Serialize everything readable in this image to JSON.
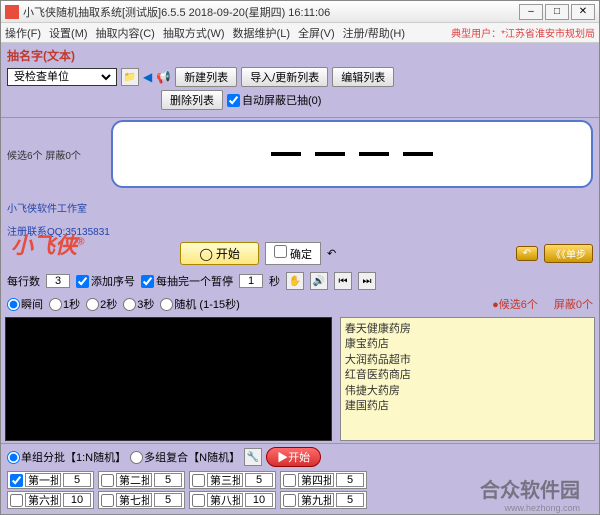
{
  "titlebar": {
    "text": "小飞侠随机抽取系统[测试版]6.5.5 2018-09-20(星期四) 16:11:06"
  },
  "menu": {
    "items": [
      "操作(F)",
      "设置(M)",
      "抽取内容(C)",
      "抽取方式(W)",
      "数据维护(L)",
      "全屏(V)",
      "注册/帮助(H)"
    ],
    "right": "典型用户：*江苏省淮安市规划局"
  },
  "toolbar": {
    "section_label": "抽名字(文本)",
    "back_icon": "◀",
    "sound_icon": "📢",
    "combo_value": "受检查单位",
    "open_icon": "📁",
    "new_list": "新建列表",
    "import_list": "导入/更新列表",
    "edit_list": "编辑列表",
    "delete_list": "删除列表",
    "auto_shield": "自动屏蔽已抽(0)"
  },
  "display": {
    "side_info": "候选6个 屏蔽0个",
    "logo": "小飞侠",
    "logo_r": "®",
    "studio": "小飞侠软件工作室",
    "contact": "注册联系QQ:35135831"
  },
  "center": {
    "start": "开始",
    "confirm": "确定",
    "undo": "↶",
    "step": "《《单步"
  },
  "options": {
    "per_row": "每行数",
    "per_row_val": "3",
    "add_seq": "添加序号",
    "pause_each": "每抽完一个暂停",
    "pause_val": "1",
    "seconds": "秒",
    "grab_icon": "✋",
    "speed_instant": "瞬间",
    "speed_1": "1秒",
    "speed_2": "2秒",
    "speed_3": "3秒",
    "speed_rand": "随机 (1-15秒)"
  },
  "right_pane": {
    "header_sel": "候选6个",
    "header_shield": "屏蔽0个",
    "items": [
      "春天健康药房",
      "康宝药店",
      "大润药品超市",
      "红音医药商店",
      "伟捷大药房",
      "建国药店"
    ]
  },
  "batch": {
    "single": "单组分批【1:N随机】",
    "multi": "多组复合【N随机】",
    "start_icon": "▶",
    "start_label": "开始",
    "cells": [
      {
        "label": "第一批",
        "count": "5"
      },
      {
        "label": "第二批",
        "count": "5"
      },
      {
        "label": "第三批",
        "count": "5"
      },
      {
        "label": "第四批",
        "count": "5"
      },
      {
        "label": "第六批",
        "count": "10"
      },
      {
        "label": "第七批",
        "count": "5"
      },
      {
        "label": "第八批",
        "count": "10"
      },
      {
        "label": "第九批",
        "count": "5"
      }
    ]
  },
  "watermark": {
    "main": "合众软件园",
    "sub": "www.hezhong.com"
  }
}
